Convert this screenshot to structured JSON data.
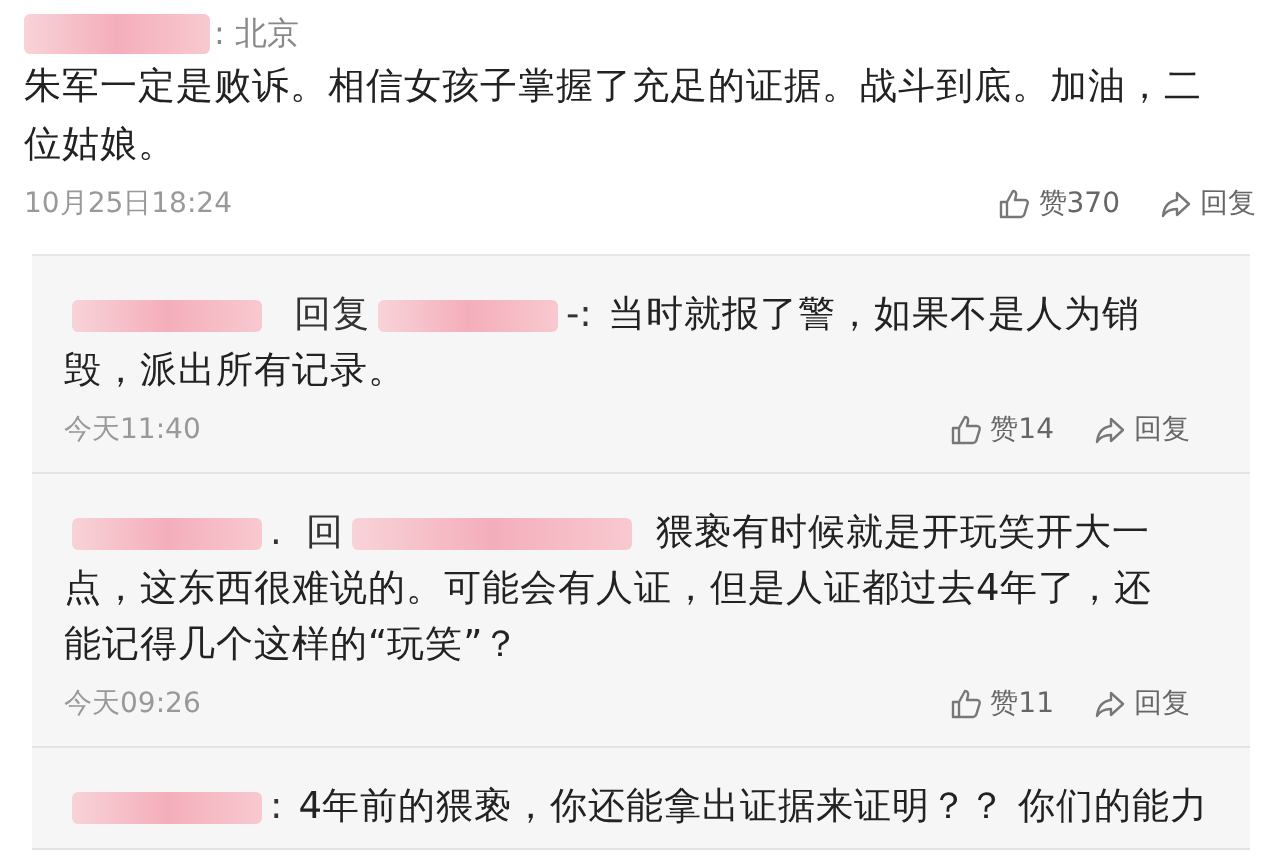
{
  "comment": {
    "author_redacted": true,
    "location": ": 北京",
    "lines": [
      "朱军一定是败诉。相信女孩子掌握了充足的证据。战斗到底。加油，二",
      "位姑娘。"
    ],
    "time": "10月25日18:24",
    "likes": "赞370",
    "reply_label": "回复"
  },
  "replies": [
    {
      "author_redacted": true,
      "reply_word": "回复",
      "target_redacted": true,
      "separator": "-:",
      "lines": [
        "当时就报了警，如果不是人为销",
        "毁，派出所有记录。"
      ],
      "time": "今天11:40",
      "likes": "赞14",
      "reply_label": "回复"
    },
    {
      "author_redacted": true,
      "author_suffix": ".",
      "reply_word": "回",
      "target_redacted": true,
      "lines": [
        "猥亵有时候就是开玩笑开大一",
        "点，这东西很难说的。可能会有人证，但是人证都过去4年了，还",
        "能记得几个这样的“玩笑”？"
      ],
      "time": "今天09:26",
      "likes": "赞11",
      "reply_label": "回复"
    },
    {
      "author_redacted": true,
      "target_redacted": false,
      "separator": ":",
      "lines": [
        "4年前的猥亵，你还能拿出证据来证明？？ 你们的能力"
      ]
    }
  ]
}
